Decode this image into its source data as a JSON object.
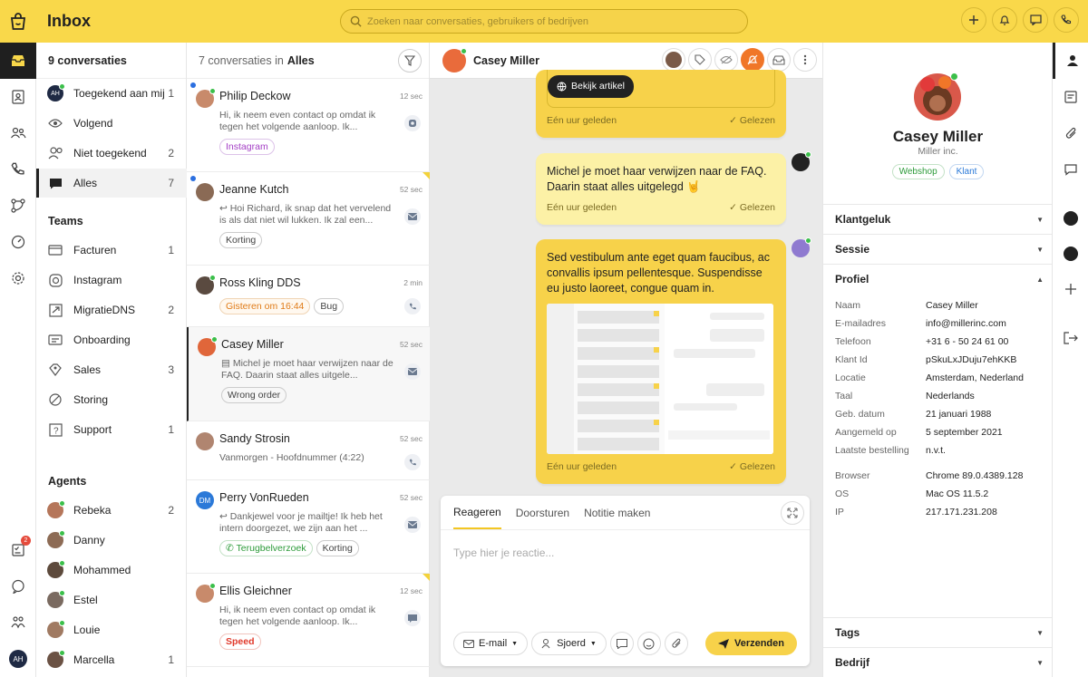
{
  "app": {
    "title": "Inbox",
    "search_placeholder": "Zoeken naar conversaties, gebruikers of bedrijven"
  },
  "rail": {
    "badge": "2",
    "user_initials": "AH"
  },
  "nav": {
    "header": "9 conversaties",
    "main": [
      {
        "label": "Toegekend aan mij",
        "count": "1",
        "icon": "avatar-ah"
      },
      {
        "label": "Volgend",
        "count": "",
        "icon": "eye-icon"
      },
      {
        "label": "Niet toegekend",
        "count": "2",
        "icon": "unassigned-icon"
      },
      {
        "label": "Alles",
        "count": "7",
        "icon": "chat-icon"
      }
    ],
    "teams_title": "Teams",
    "teams": [
      {
        "label": "Facturen",
        "count": "1"
      },
      {
        "label": "Instagram",
        "count": ""
      },
      {
        "label": "MigratieDNS",
        "count": "2"
      },
      {
        "label": "Onboarding",
        "count": ""
      },
      {
        "label": "Sales",
        "count": "3"
      },
      {
        "label": "Storing",
        "count": ""
      },
      {
        "label": "Support",
        "count": "1"
      }
    ],
    "agents_title": "Agents",
    "agents": [
      {
        "label": "Rebeka",
        "count": "2"
      },
      {
        "label": "Danny",
        "count": ""
      },
      {
        "label": "Mohammed",
        "count": ""
      },
      {
        "label": "Estel",
        "count": ""
      },
      {
        "label": "Louie",
        "count": ""
      },
      {
        "label": "Marcella",
        "count": "1"
      }
    ]
  },
  "list": {
    "count_text": "7 conversaties in",
    "scope": "Alles",
    "conversations": [
      {
        "name": "Philip Deckow",
        "time": "12 sec",
        "preview": "Hi, ik neem even contact op omdat ik tegen het volgende aanloop. Ik...",
        "tags": [
          "Instagram"
        ]
      },
      {
        "name": "Jeanne Kutch",
        "time": "52 sec",
        "preview": "Hoi Richard, ik snap dat het vervelend is als dat niet wil lukken. Ik zal een...",
        "tags": [
          "Korting"
        ]
      },
      {
        "name": "Ross Kling DDS",
        "time": "2 min",
        "preview": "",
        "tags": [
          "Gisteren om 16:44",
          "Bug"
        ]
      },
      {
        "name": "Casey Miller",
        "time": "52 sec",
        "preview": "Michel je moet haar verwijzen naar de FAQ. Daarin staat alles uitgele...",
        "tags": [
          "Wrong order"
        ]
      },
      {
        "name": "Sandy Strosin",
        "time": "52 sec",
        "preview": "Vanmorgen - Hoofdnummer (4:22)",
        "tags": []
      },
      {
        "name": "Perry VonRueden",
        "initials": "DM",
        "time": "52 sec",
        "preview": "Dankjewel voor je mailtje! Ik heb het intern doorgezet, we zijn aan het ...",
        "tags": [
          "Terugbelverzoek",
          "Korting"
        ]
      },
      {
        "name": "Ellis Gleichner",
        "time": "12 sec",
        "preview": "Hi, ik neem even contact op omdat ik tegen het volgende aanloop. Ik...",
        "tags": [
          "Speed"
        ]
      }
    ]
  },
  "chat": {
    "contact": "Casey Miller",
    "messages": [
      {
        "button": "Bekijk artikel",
        "time": "Eén uur geleden",
        "status": "Gelezen"
      },
      {
        "text": "Michel je moet haar verwijzen naar de FAQ. Daarin staat alles uitgelegd 🤘",
        "time": "Eén uur geleden",
        "status": "Gelezen"
      },
      {
        "text": "Sed vestibulum ante eget quam faucibus, ac convallis ipsum pellentesque. Suspendisse eu justo laoreet, congue quam in.",
        "time": "Eén uur geleden",
        "status": "Gelezen"
      }
    ],
    "composer": {
      "tabs": [
        "Reageren",
        "Doorsturen",
        "Notitie maken"
      ],
      "placeholder": "Type hier je reactie...",
      "channel": "E-mail",
      "agent": "Sjoerd",
      "send": "Verzenden"
    }
  },
  "profile": {
    "name": "Casey Miller",
    "company": "Miller inc.",
    "tags": [
      "Webshop",
      "Klant"
    ],
    "sections": {
      "happiness": "Klantgeluk",
      "session": "Sessie",
      "profile": "Profiel",
      "tags": "Tags",
      "company": "Bedrijf"
    },
    "fields": [
      {
        "k": "Naam",
        "v": "Casey Miller"
      },
      {
        "k": "E-mailadres",
        "v": "info@millerinc.com"
      },
      {
        "k": "Telefoon",
        "v": "+31 6 - 50 24 61 00"
      },
      {
        "k": "Klant Id",
        "v": "pSkuLxJDuju7ehKKB"
      },
      {
        "k": "Locatie",
        "v": "Amsterdam, Nederland"
      },
      {
        "k": "Taal",
        "v": "Nederlands"
      },
      {
        "k": "Geb. datum",
        "v": "21 januari 1988"
      },
      {
        "k": "Aangemeld op",
        "v": "5 september 2021"
      },
      {
        "k": "Laatste bestelling",
        "v": "n.v.t."
      }
    ],
    "session_fields": [
      {
        "k": "Browser",
        "v": "Chrome 89.0.4389.128"
      },
      {
        "k": "OS",
        "v": "Mac OS 11.5.2"
      },
      {
        "k": "IP",
        "v": "217.171.231.208"
      }
    ]
  },
  "colors": {
    "brand": "#f9d84a",
    "bubble": "#f7d24a",
    "dark": "#1f1f1f"
  }
}
